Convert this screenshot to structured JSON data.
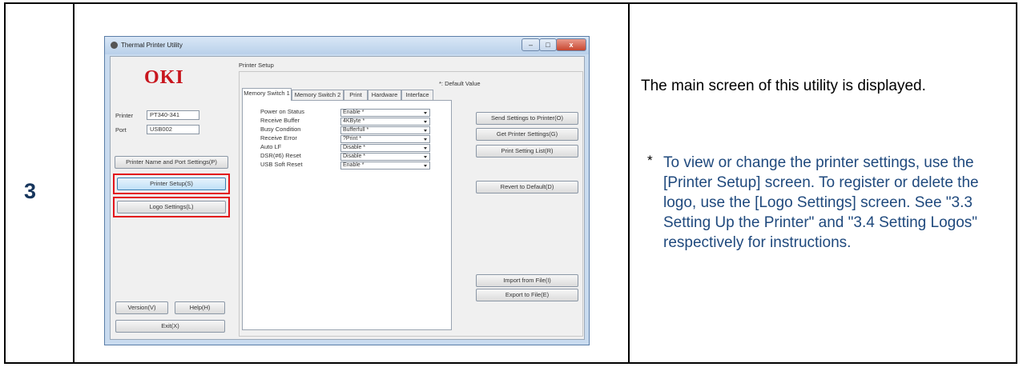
{
  "step": "3",
  "window": {
    "title": "Thermal Printer Utility",
    "logo": "OKI",
    "printer_label": "Printer",
    "printer_value": "PT340-341",
    "port_label": "Port",
    "port_value": "USB002",
    "buttons": {
      "name_port": "Printer Name and Port Settings(P)",
      "printer_setup": "Printer Setup(S)",
      "logo_settings": "Logo Settings(L)",
      "version": "Version(V)",
      "help": "Help(H)",
      "exit": "Exit(X)"
    },
    "group_title": "Printer Setup",
    "default_note": "*: Default Value",
    "tabs": [
      "Memory Switch 1",
      "Memory Switch 2",
      "Print",
      "Hardware",
      "Interface"
    ],
    "settings": [
      {
        "label": "Power on Status",
        "value": "Enable *"
      },
      {
        "label": "Receive Buffer",
        "value": "4KByte *"
      },
      {
        "label": "Busy Condition",
        "value": "Bufferfull *"
      },
      {
        "label": "Receive Error",
        "value": "?Print *"
      },
      {
        "label": "Auto LF",
        "value": "Disable *"
      },
      {
        "label": "DSR(#6) Reset",
        "value": "Disable *"
      },
      {
        "label": "USB Soft Reset",
        "value": "Enable *"
      }
    ],
    "actions": {
      "send": "Send Settings to Printer(O)",
      "get": "Get Printer Settings(G)",
      "print_list": "Print Setting List(R)",
      "revert": "Revert to Default(D)",
      "import": "Import from File(I)",
      "export": "Export to File(E)"
    }
  },
  "description": "The main screen of this utility is displayed.",
  "note_marker": "*",
  "note": "To view or change the printer settings, use the [Printer Setup] screen. To register or delete the logo, use the [Logo Settings] screen. See \"3.3 Setting Up the Printer\" and \"3.4 Setting Logos\" respectively for instructions."
}
